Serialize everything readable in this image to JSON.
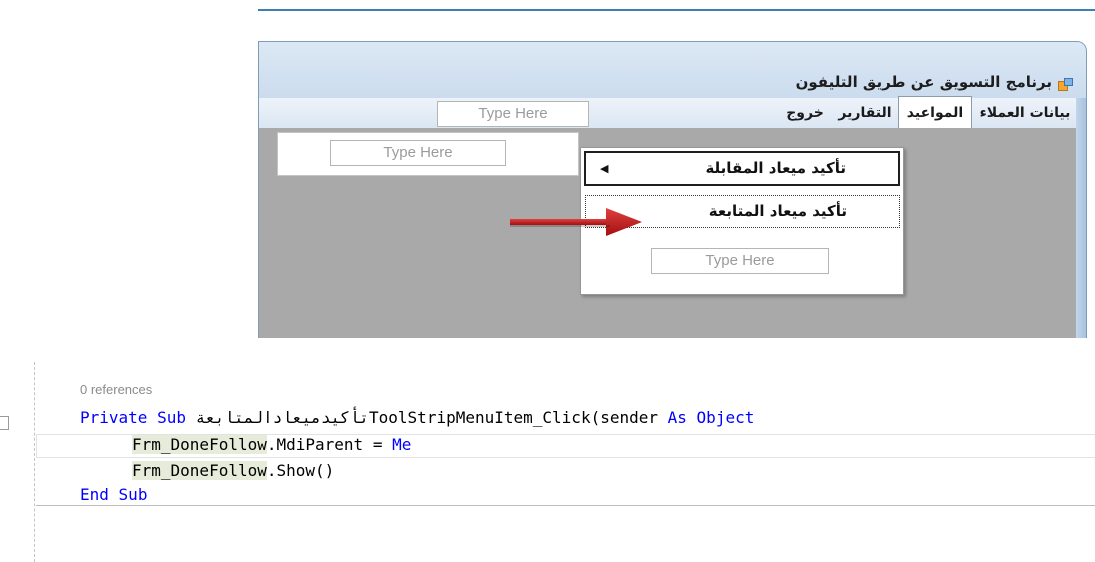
{
  "designer": {
    "title": "برنامج التسويق عن طريق التليفون",
    "menus": [
      {
        "label": "بيانات العملاء"
      },
      {
        "label": "المواعيد"
      },
      {
        "label": "التقارير"
      },
      {
        "label": "خروج"
      }
    ],
    "type_here": "Type Here",
    "submenu_type_here": "Type Here",
    "dropdown": {
      "items": [
        {
          "label": "تأكيد ميعاد المقابلة",
          "has_submenu": true
        },
        {
          "label": "تأكيد ميعاد المتابعة"
        }
      ],
      "type_here": "Type Here"
    }
  },
  "editor": {
    "references": "0 references",
    "lines": {
      "l1_kw1": "Private",
      "l1_kw2": "Sub",
      "l1_name": "تأكيدميعادالمتابعةToolStripMenuItem_Click(sender",
      "l1_as": "As",
      "l1_type": "Object",
      "l2_obj": "Frm_DoneFollow",
      "l2_rest": ".MdiParent = ",
      "l2_me": "Me",
      "l3_obj": "Frm_DoneFollow",
      "l3_rest": ".Show()",
      "l4_kw1": "End",
      "l4_kw2": "Sub"
    }
  }
}
